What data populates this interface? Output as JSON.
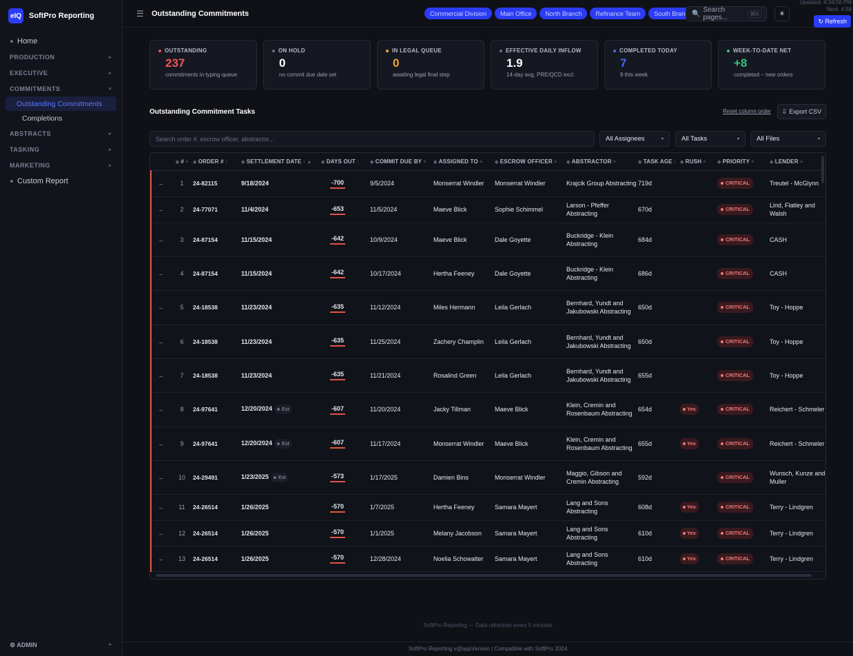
{
  "brand": {
    "logo": "eIQ",
    "name": "SoftPro Reporting"
  },
  "sidebar": {
    "home": "Home",
    "sections": [
      {
        "label": "PRODUCTION"
      },
      {
        "label": "EXECUTIVE"
      },
      {
        "label": "COMMITMENTS"
      },
      {
        "label": "ABSTRACTS"
      },
      {
        "label": "TASKING"
      },
      {
        "label": "MARKETING"
      }
    ],
    "commitments_items": [
      "Outstanding Commitments",
      "Completions"
    ],
    "custom_report": "Custom Report",
    "footer": "⚙ ADMIN"
  },
  "topbar": {
    "title": "Outstanding Commitments",
    "chips": [
      "Commercial Division",
      "Main Office",
      "North Branch",
      "Refinance Team",
      "South Branch"
    ],
    "search_placeholder": "Search pages...",
    "search_shortcut": "⌘K",
    "updated": "Updated: 4:34:56 PM",
    "next": "Next: 4:58",
    "refresh": "↻ Refresh"
  },
  "stats": [
    {
      "label": "OUTSTANDING",
      "value": "237",
      "sub": "commitments in typing queue",
      "color": "#f2555a",
      "dot": "#f2555a"
    },
    {
      "label": "ON HOLD",
      "value": "0",
      "sub": "no commit due date set",
      "color": "#ffffff",
      "dot": "#6b7084"
    },
    {
      "label": "IN LEGAL QUEUE",
      "value": "0",
      "sub": "awaiting legal final step",
      "color": "#f0a33a",
      "dot": "#f0a33a"
    },
    {
      "label": "EFFECTIVE DAILY INFLOW",
      "value": "1.9",
      "sub": "14-day avg, PRE/QCD excl.",
      "color": "#ffffff",
      "dot": "#6b7084"
    },
    {
      "label": "COMPLETED TODAY",
      "value": "7",
      "sub": "9 this week",
      "color": "#4a63ff",
      "dot": "#4a63ff"
    },
    {
      "label": "WEEK-TO-DATE NET",
      "value": "+8",
      "sub": "completed − new orders",
      "color": "#35c27a",
      "dot": "#35c27a"
    }
  ],
  "table_section": {
    "title": "Outstanding Commitment Tasks",
    "reset": "Reset column order",
    "export": "Export CSV",
    "search_placeholder": "Search order #, escrow officer, abstractor...",
    "filters": [
      "All Assignees",
      "All Tasks",
      "All Files"
    ]
  },
  "columns": [
    "#",
    "ORDER #",
    "SETTLEMENT DATE",
    "DAYS OUT",
    "COMMIT DUE BY",
    "ASSIGNED TO",
    "ESCROW OFFICER",
    "ABSTRACTOR",
    "TASK AGE",
    "RUSH",
    "PRIORITY",
    "LENDER"
  ],
  "rows": [
    {
      "n": "1",
      "order": "24-82115",
      "settle": "9/18/2024",
      "est": "",
      "days": "-700",
      "due": "9/5/2024",
      "assigned": "Monserrat Windler",
      "escrow": "Monserrat Windler",
      "abstractor": "Krajcik Group Abstracting",
      "age": "719d",
      "rush": "",
      "priority": "CRITICAL",
      "lender": "Treutel - McGlynn"
    },
    {
      "n": "2",
      "order": "24-77071",
      "settle": "11/4/2024",
      "est": "",
      "days": "-653",
      "due": "11/5/2024",
      "assigned": "Maeve Blick",
      "escrow": "Sophie Schimmel",
      "abstractor": "Larson - Pfeffer Abstracting",
      "age": "670d",
      "rush": "",
      "priority": "CRITICAL",
      "lender": "Lind, Flatley and Walsh"
    },
    {
      "n": "3",
      "order": "24-87154",
      "settle": "11/15/2024",
      "est": "",
      "days": "-642",
      "due": "10/9/2024",
      "assigned": "Maeve Blick",
      "escrow": "Dale Goyette",
      "abstractor": "Buckridge - Klein Abstracting",
      "age": "684d",
      "rush": "",
      "priority": "CRITICAL",
      "lender": "CASH"
    },
    {
      "n": "4",
      "order": "24-87154",
      "settle": "11/15/2024",
      "est": "",
      "days": "-642",
      "due": "10/17/2024",
      "assigned": "Hertha Feeney",
      "escrow": "Dale Goyette",
      "abstractor": "Buckridge - Klein Abstracting",
      "age": "686d",
      "rush": "",
      "priority": "CRITICAL",
      "lender": "CASH"
    },
    {
      "n": "5",
      "order": "24-18538",
      "settle": "11/23/2024",
      "est": "",
      "days": "-635",
      "due": "11/12/2024",
      "assigned": "Miles Hermann",
      "escrow": "Leila Gerlach",
      "abstractor": "Bernhard, Yundt and Jakubowski Abstracting",
      "age": "650d",
      "rush": "",
      "priority": "CRITICAL",
      "lender": "Toy - Hoppe"
    },
    {
      "n": "6",
      "order": "24-18538",
      "settle": "11/23/2024",
      "est": "",
      "days": "-635",
      "due": "11/25/2024",
      "assigned": "Zachery Champlin",
      "escrow": "Leila Gerlach",
      "abstractor": "Bernhard, Yundt and Jakubowski Abstracting",
      "age": "650d",
      "rush": "",
      "priority": "CRITICAL",
      "lender": "Toy - Hoppe"
    },
    {
      "n": "7",
      "order": "24-18538",
      "settle": "11/23/2024",
      "est": "",
      "days": "-635",
      "due": "11/21/2024",
      "assigned": "Rosalind Green",
      "escrow": "Leila Gerlach",
      "abstractor": "Bernhard, Yundt and Jakubowski Abstracting",
      "age": "655d",
      "rush": "",
      "priority": "CRITICAL",
      "lender": "Toy - Hoppe"
    },
    {
      "n": "8",
      "order": "24-97641",
      "settle": "12/20/2024",
      "est": "Est",
      "days": "-607",
      "due": "11/20/2024",
      "assigned": "Jacky Tillman",
      "escrow": "Maeve Blick",
      "abstractor": "Klein, Cremin and Rosenbaum Abstracting",
      "age": "654d",
      "rush": "Yes",
      "priority": "CRITICAL",
      "lender": "Reichert - Schmeler"
    },
    {
      "n": "9",
      "order": "24-97641",
      "settle": "12/20/2024",
      "est": "Est",
      "days": "-607",
      "due": "11/17/2024",
      "assigned": "Monserrat Windler",
      "escrow": "Maeve Blick",
      "abstractor": "Klein, Cremin and Rosenbaum Abstracting",
      "age": "655d",
      "rush": "Yes",
      "priority": "CRITICAL",
      "lender": "Reichert - Schmeler"
    },
    {
      "n": "10",
      "order": "24-29491",
      "settle": "1/23/2025",
      "est": "Est",
      "days": "-573",
      "due": "1/17/2025",
      "assigned": "Damien Bins",
      "escrow": "Monserrat Windler",
      "abstractor": "Maggio, Gibson and Cremin Abstracting",
      "age": "592d",
      "rush": "",
      "priority": "CRITICAL",
      "lender": "Wunsch, Kunze and Muller"
    },
    {
      "n": "11",
      "order": "24-26514",
      "settle": "1/26/2025",
      "est": "",
      "days": "-570",
      "due": "1/7/2025",
      "assigned": "Hertha Feeney",
      "escrow": "Samara Mayert",
      "abstractor": "Lang and Sons Abstracting",
      "age": "608d",
      "rush": "Yes",
      "priority": "CRITICAL",
      "lender": "Terry - Lindgren"
    },
    {
      "n": "12",
      "order": "24-26514",
      "settle": "1/26/2025",
      "est": "",
      "days": "-570",
      "due": "1/1/2025",
      "assigned": "Melany Jacobson",
      "escrow": "Samara Mayert",
      "abstractor": "Lang and Sons Abstracting",
      "age": "610d",
      "rush": "Yes",
      "priority": "CRITICAL",
      "lender": "Terry - Lindgren"
    },
    {
      "n": "13",
      "order": "24-26514",
      "settle": "1/26/2025",
      "est": "",
      "days": "-570",
      "due": "12/28/2024",
      "assigned": "Noelia Schowalter",
      "escrow": "Samara Mayert",
      "abstractor": "Lang and Sons Abstracting",
      "age": "610d",
      "rush": "Yes",
      "priority": "CRITICAL",
      "lender": "Terry - Lindgren"
    }
  ],
  "footer": {
    "line1": "SoftPro Reporting — Data refreshes every 5 minutes",
    "line2": "SoftPro Reporting v@appVersion  |  Compatible with SoftPro 2024"
  }
}
